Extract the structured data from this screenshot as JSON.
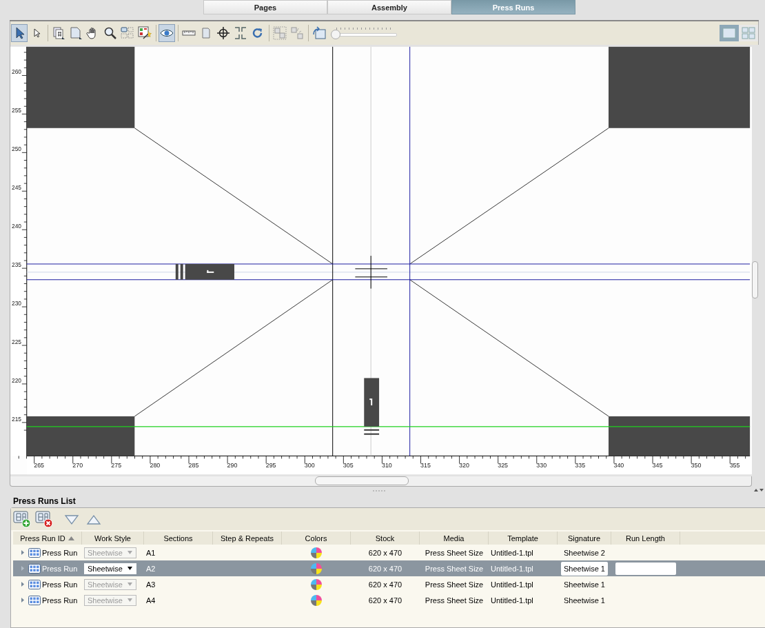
{
  "tabs": [
    {
      "label": "Pages",
      "selected": false
    },
    {
      "label": "Assembly",
      "selected": false
    },
    {
      "label": "Press Runs",
      "selected": true
    }
  ],
  "toolbar": {
    "tools": [
      {
        "kind": "pointer",
        "selected": true
      },
      {
        "kind": "direct-select",
        "selected": false
      },
      {
        "kind": "page-number",
        "selected": false
      },
      {
        "kind": "page",
        "selected": false
      },
      {
        "kind": "hand",
        "selected": false
      },
      {
        "kind": "zoom",
        "selected": false
      },
      {
        "kind": "layout",
        "selected": false
      },
      {
        "kind": "wizard",
        "selected": false
      },
      {
        "kind": "eye",
        "selected": true
      },
      {
        "kind": "ruler",
        "selected": false
      },
      {
        "kind": "document",
        "selected": false
      },
      {
        "kind": "crosshair",
        "selected": false
      },
      {
        "kind": "trim-marks",
        "selected": false
      },
      {
        "kind": "rotate",
        "selected": false
      },
      {
        "kind": "group",
        "selected": false
      },
      {
        "kind": "ungroup",
        "selected": false
      },
      {
        "kind": "flip",
        "selected": false
      }
    ],
    "zoom_slider": {
      "level": 0
    },
    "view_modes": [
      {
        "kind": "single",
        "selected": true
      },
      {
        "kind": "grid",
        "selected": false
      }
    ]
  },
  "canvas": {
    "y_ruler": [
      "260",
      "255",
      "250",
      "245",
      "240",
      "235",
      "230",
      "225",
      "220",
      "215"
    ],
    "x_ruler": [
      "265",
      "270",
      "275",
      "280",
      "285",
      "290",
      "295",
      "300",
      "305",
      "310",
      "315",
      "320",
      "325",
      "330",
      "335",
      "340",
      "345",
      "350",
      "355"
    ]
  },
  "press_runs_list": {
    "title": "Press Runs List",
    "actions": [
      {
        "kind": "add"
      },
      {
        "kind": "delete"
      },
      {
        "kind": "move-down"
      },
      {
        "kind": "move-up"
      }
    ],
    "columns": [
      {
        "label": "Press Run ID",
        "sorted": true
      },
      {
        "label": "Work Style",
        "sorted": false
      },
      {
        "label": "Sections",
        "sorted": false
      },
      {
        "label": "Step & Repeats",
        "sorted": false
      },
      {
        "label": "Colors",
        "sorted": false
      },
      {
        "label": "Stock",
        "sorted": false
      },
      {
        "label": "Media",
        "sorted": false
      },
      {
        "label": "Template",
        "sorted": false
      },
      {
        "label": "Signature",
        "sorted": false
      },
      {
        "label": "Run Length",
        "sorted": false
      }
    ],
    "rows": [
      {
        "id": "Press Run",
        "work_style": "Sheetwise",
        "sections": "A1",
        "stock": "620 x 470",
        "media": "Press Sheet Size",
        "template": "Untitled-1.tpl",
        "signature": "Sheetwise 2",
        "selected": false
      },
      {
        "id": "Press Run",
        "work_style": "Sheetwise",
        "sections": "A2",
        "stock": "620 x 470",
        "media": "Press Sheet Size",
        "template": "Untitled-1.tpl",
        "signature": "Sheetwise 1",
        "selected": true
      },
      {
        "id": "Press Run",
        "work_style": "Sheetwise",
        "sections": "A3",
        "stock": "620 x 470",
        "media": "Press Sheet Size",
        "template": "Untitled-1.tpl",
        "signature": "Sheetwise 1",
        "selected": false
      },
      {
        "id": "Press Run",
        "work_style": "Sheetwise",
        "sections": "A4",
        "stock": "620 x 470",
        "media": "Press Sheet Size",
        "template": "Untitled-1.tpl",
        "signature": "Sheetwise 1",
        "selected": false
      }
    ]
  }
}
